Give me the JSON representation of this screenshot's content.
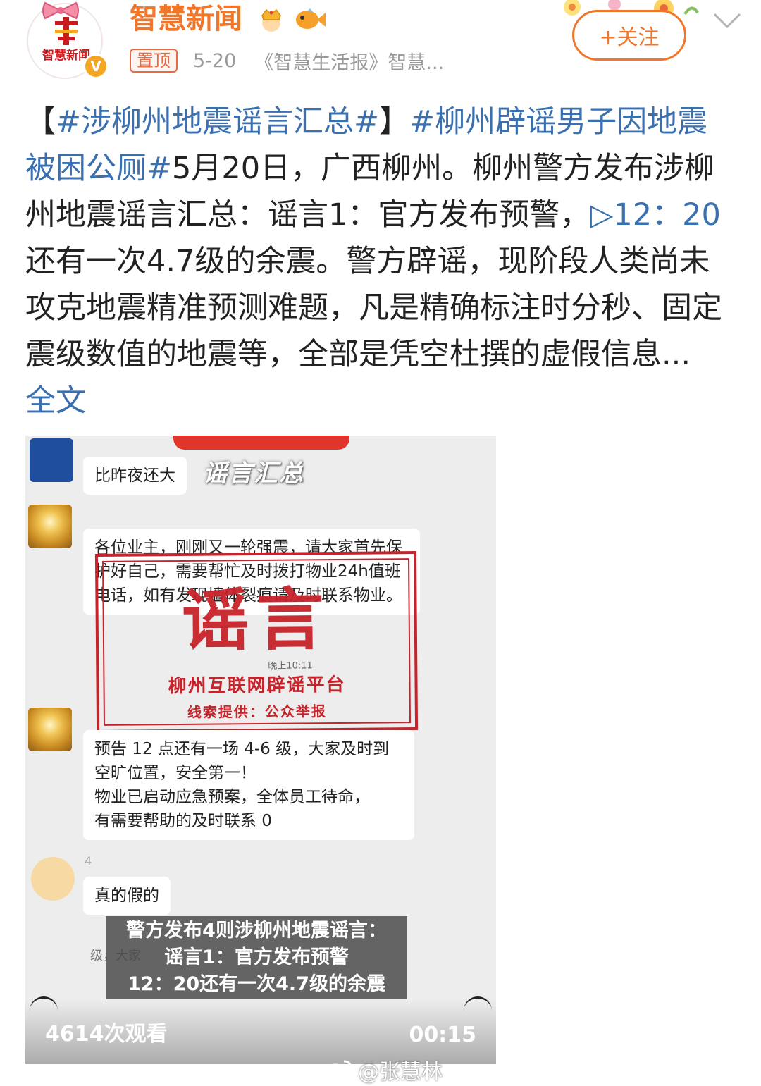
{
  "header": {
    "username": "智慧新闻",
    "avatar_text": "智慧新闻",
    "verified_mark": "V",
    "pin_label": "置顶",
    "date": "5-20",
    "source": "《智慧生活报》智慧...",
    "follow_label": "+关注"
  },
  "post": {
    "tag1": "#涉柳州地震谣言汇总#",
    "bracket_open": "【",
    "bracket_close": "】",
    "tag2": "#柳州辟谣男子因地震被困公厕#",
    "text1": "5月20日，广西柳州。柳州警方发布涉柳州地震谣言汇总：谣言1：官方发布预警，",
    "video_link": "▷12：20",
    "text2": " 还有一次4.7级的余震。警方辟谣，现阶段人类尚未攻克地震精准预测难题，凡是精确标注时分秒、固定震级数值的地震等，全部是凭空杜撰的虚假信息...",
    "full_text": " 全文"
  },
  "video": {
    "overlay_title": "谣言汇总",
    "chat": {
      "msg1": "比昨夜还大",
      "msg2": "各位业主，刚刚又一轮强震，请大家首先保护好自己，需要帮忙及时拨打物业24h值班电话，如有发现墙体裂痕请及时联系物业。",
      "msg3_line1": "预告 12 点还有一场 4-6 级，大家及时到",
      "msg3_line2": "空旷位置，安全第一！",
      "msg3_line3": "物业已启动应急预案，全体员工待命，",
      "msg3_line4": "有需要帮助的及时联系 0",
      "msg4": "真的假的",
      "name4": "4",
      "partial": "级，大家"
    },
    "stamp": {
      "big": "谣言",
      "time": "晚上10:11",
      "org": "柳州互联网辟谣平台",
      "clue": "线索提供：公众举报"
    },
    "caption": {
      "line1": "警方发布4则涉柳州地震谣言：",
      "line2": "谣言1：官方发布预警",
      "line3": "12：20还有一次4.7级的余震"
    },
    "views": "4614次观看",
    "duration": "00:15"
  },
  "watermark": "@张慧林",
  "colors": {
    "brand_orange": "#f2762a",
    "link_blue": "#3a6fb0",
    "stamp_red": "#c8232b"
  }
}
